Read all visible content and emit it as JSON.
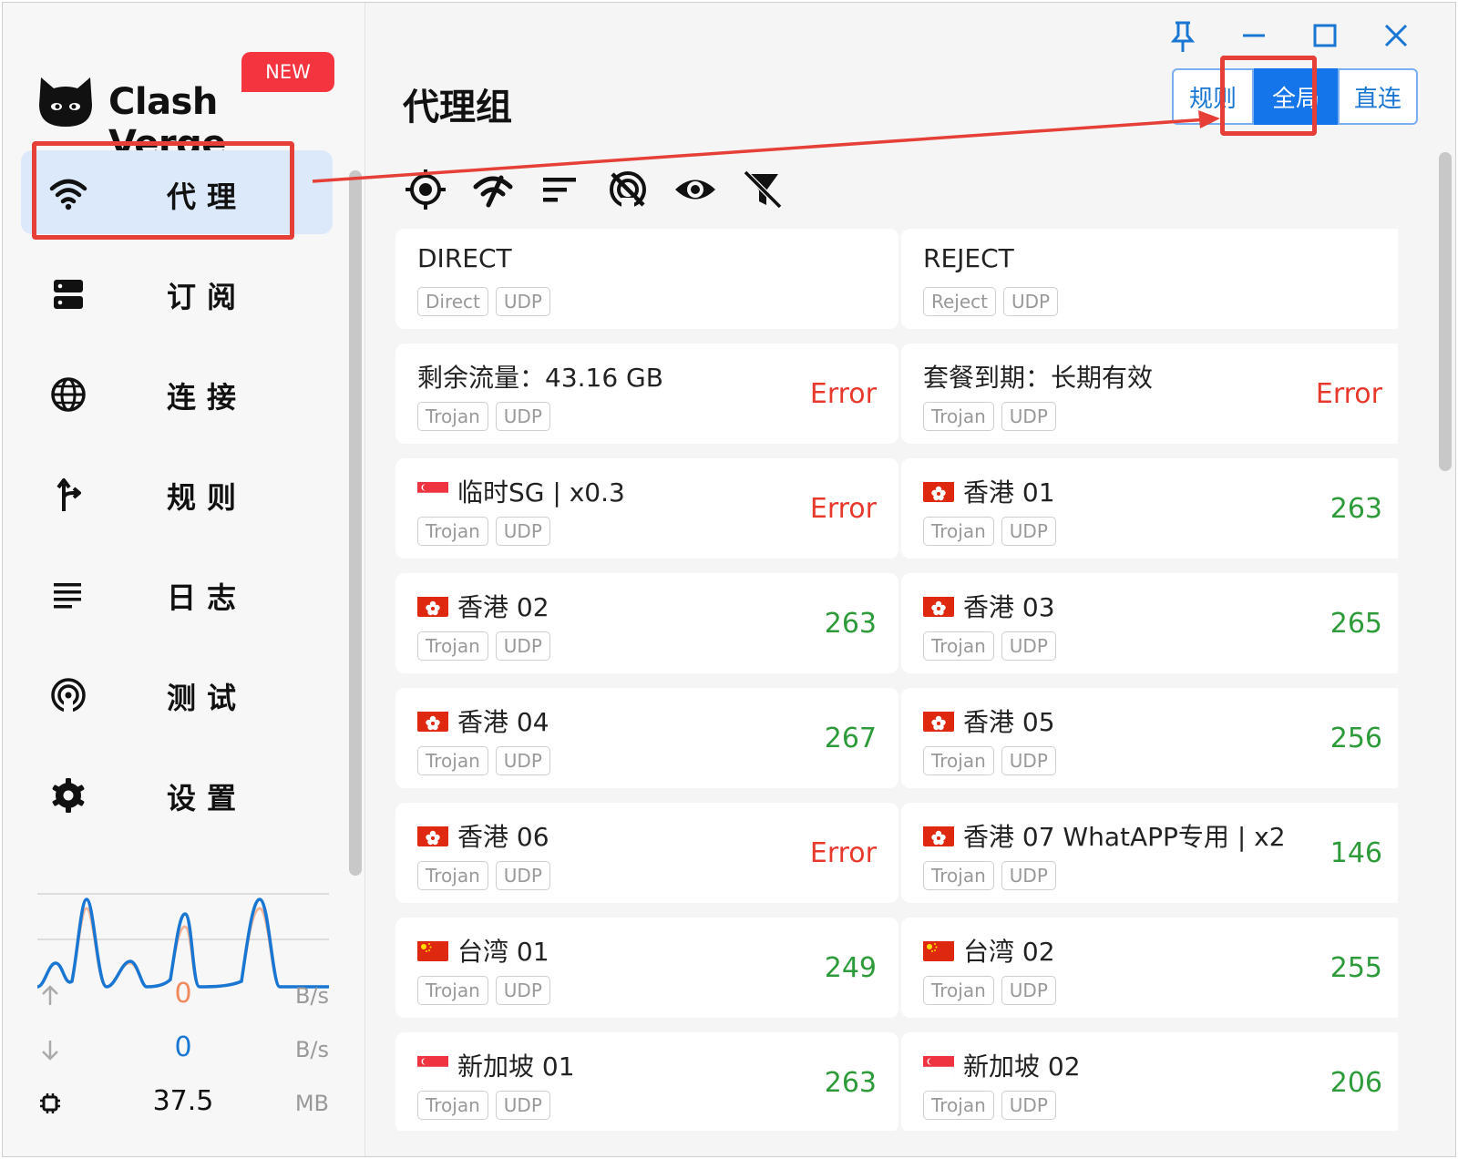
{
  "app": {
    "brand": "Clash Verge",
    "new_badge": "NEW"
  },
  "sidebar": {
    "items": [
      {
        "label": "代理",
        "icon": "wifi-icon",
        "active": true
      },
      {
        "label": "订阅",
        "icon": "server-icon",
        "active": false
      },
      {
        "label": "连接",
        "icon": "globe-icon",
        "active": false
      },
      {
        "label": "规则",
        "icon": "fork-arrow-icon",
        "active": false
      },
      {
        "label": "日志",
        "icon": "lines-icon",
        "active": false
      },
      {
        "label": "测试",
        "icon": "broadcast-icon",
        "active": false
      },
      {
        "label": "设置",
        "icon": "gear-icon",
        "active": false
      }
    ],
    "traffic": {
      "up_value": "0",
      "up_unit": "B/s",
      "down_value": "0",
      "down_unit": "B/s",
      "mem_value": "37.5",
      "mem_unit": "MB"
    },
    "colors": {
      "up": "#f08a5d",
      "down": "#1976d2"
    }
  },
  "header": {
    "title": "代理组",
    "modes": [
      {
        "label": "规则",
        "selected": false
      },
      {
        "label": "全局",
        "selected": true
      },
      {
        "label": "直连",
        "selected": false
      }
    ]
  },
  "window_controls": [
    "pin-icon",
    "minimize-icon",
    "maximize-icon",
    "close-icon"
  ],
  "toolbar": [
    "locate-icon",
    "speed-test-icon",
    "sort-icon",
    "no-signal-icon",
    "eye-icon",
    "filter-off-icon"
  ],
  "proxies": [
    {
      "name": "DIRECT",
      "flag": "",
      "tags": [
        "Direct",
        "UDP"
      ],
      "latency": ""
    },
    {
      "name": "REJECT",
      "flag": "",
      "tags": [
        "Reject",
        "UDP"
      ],
      "latency": ""
    },
    {
      "name": "剩余流量：43.16 GB",
      "flag": "",
      "tags": [
        "Trojan",
        "UDP"
      ],
      "latency": "Error"
    },
    {
      "name": "套餐到期：长期有效",
      "flag": "",
      "tags": [
        "Trojan",
        "UDP"
      ],
      "latency": "Error"
    },
    {
      "name": "临时SG | x0.3",
      "flag": "sg",
      "tags": [
        "Trojan",
        "UDP"
      ],
      "latency": "Error"
    },
    {
      "name": "香港 01",
      "flag": "hk",
      "tags": [
        "Trojan",
        "UDP"
      ],
      "latency": "263"
    },
    {
      "name": "香港 02",
      "flag": "hk",
      "tags": [
        "Trojan",
        "UDP"
      ],
      "latency": "263"
    },
    {
      "name": "香港 03",
      "flag": "hk",
      "tags": [
        "Trojan",
        "UDP"
      ],
      "latency": "265"
    },
    {
      "name": "香港 04",
      "flag": "hk",
      "tags": [
        "Trojan",
        "UDP"
      ],
      "latency": "267"
    },
    {
      "name": "香港 05",
      "flag": "hk",
      "tags": [
        "Trojan",
        "UDP"
      ],
      "latency": "256"
    },
    {
      "name": "香港 06",
      "flag": "hk",
      "tags": [
        "Trojan",
        "UDP"
      ],
      "latency": "Error"
    },
    {
      "name": "香港 07 WhatAPP专用 | x2",
      "flag": "hk",
      "tags": [
        "Trojan",
        "UDP"
      ],
      "latency": "146"
    },
    {
      "name": "台湾 01",
      "flag": "tw",
      "tags": [
        "Trojan",
        "UDP"
      ],
      "latency": "249"
    },
    {
      "name": "台湾 02",
      "flag": "tw",
      "tags": [
        "Trojan",
        "UDP"
      ],
      "latency": "255"
    },
    {
      "name": "新加坡 01",
      "flag": "sg",
      "tags": [
        "Trojan",
        "UDP"
      ],
      "latency": "263"
    },
    {
      "name": "新加坡 02",
      "flag": "sg",
      "tags": [
        "Trojan",
        "UDP"
      ],
      "latency": "206"
    }
  ]
}
